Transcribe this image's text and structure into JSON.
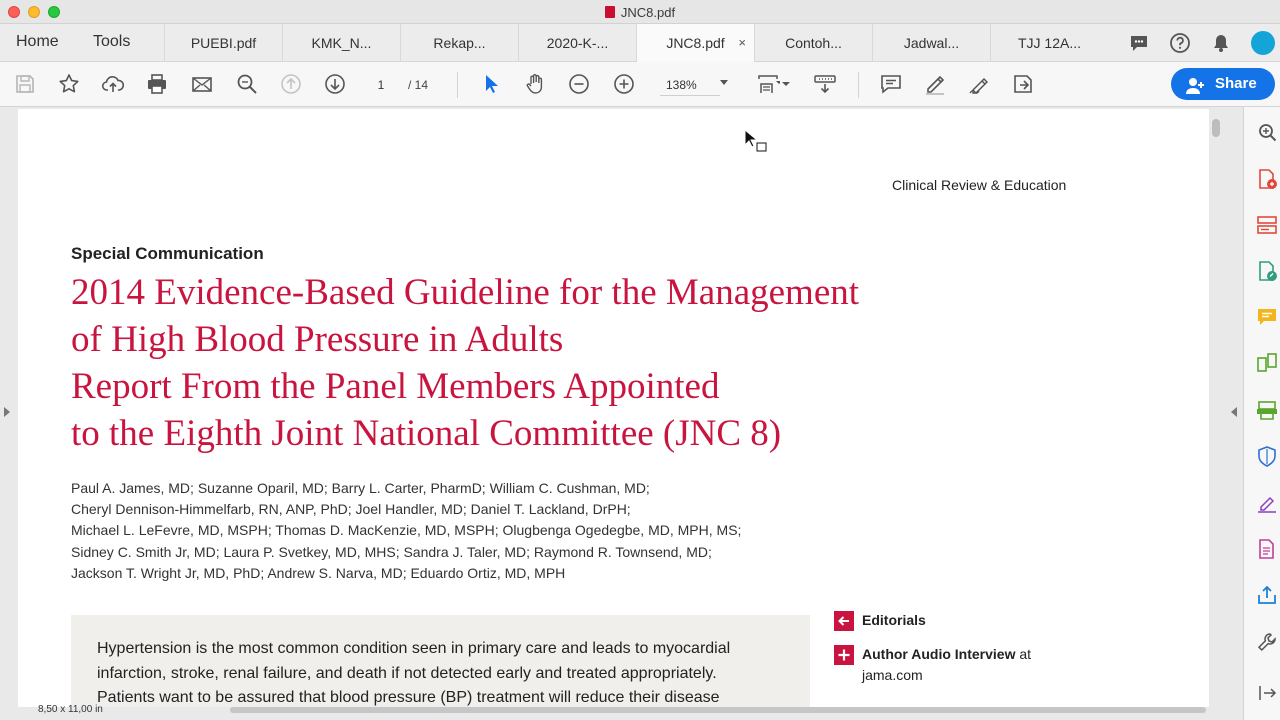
{
  "window": {
    "title": "JNC8.pdf"
  },
  "nav": {
    "home": "Home",
    "tools": "Tools"
  },
  "tabs": [
    {
      "label": "PUEBI.pdf"
    },
    {
      "label": "KMK_N..."
    },
    {
      "label": "Rekap..."
    },
    {
      "label": "2020-K-..."
    },
    {
      "label": "JNC8.pdf",
      "active": true,
      "close": "×"
    },
    {
      "label": "Contoh..."
    },
    {
      "label": "Jadwal..."
    },
    {
      "label": "TJJ 12A..."
    }
  ],
  "toolbar": {
    "page_current": "1",
    "page_total": "/ 14",
    "zoom": "138%",
    "share_label": "Share"
  },
  "colors": {
    "accent": "#1473e6",
    "title_red": "#c8143e",
    "abstract_bg": "#f0efec"
  },
  "document": {
    "section_label": "Clinical Review & Education",
    "kicker": "Special Communication",
    "title_line1": "2014 Evidence-Based Guideline for the Management",
    "title_line2": "of High Blood Pressure in Adults",
    "subtitle_line1": "Report From the Panel Members Appointed",
    "subtitle_line2": "to the Eighth Joint National Committee (JNC 8)",
    "authors": [
      "Paul A. James, MD; Suzanne Oparil, MD; Barry L. Carter, PharmD; William C. Cushman, MD;",
      "Cheryl Dennison-Himmelfarb, RN, ANP, PhD; Joel Handler, MD; Daniel T. Lackland, DrPH;",
      "Michael L. LeFevre, MD, MSPH; Thomas D. MacKenzie, MD, MSPH; Olugbenga Ogedegbe, MD, MPH, MS;",
      "Sidney C. Smith Jr, MD; Laura P. Svetkey, MD, MHS; Sandra J. Taler, MD; Raymond R. Townsend, MD;",
      "Jackson T. Wright Jr, MD, PhD; Andrew S. Narva, MD; Eduardo Ortiz, MD, MPH"
    ],
    "abstract_lines": [
      "Hypertension is the most common condition seen in primary care and leads to myocardial",
      "infarction, stroke, renal failure, and death if not detected early and treated appropriately.",
      "Patients want to be assured that blood pressure (BP) treatment will reduce their disease"
    ],
    "related": {
      "editorials": "Editorials",
      "audio_bold": "Author Audio Interview",
      "audio_rest": " at",
      "audio_line2": "jama.com"
    },
    "page_size": "8,50 x 11,00 in"
  },
  "icons": {
    "toolbar": [
      "save-icon",
      "star-icon",
      "upload-cloud-icon",
      "print-icon",
      "mail-icon",
      "zoom-search-icon",
      "page-up-icon",
      "page-down-icon",
      "select-arrow-icon",
      "hand-icon",
      "zoom-out-icon",
      "zoom-in-icon",
      "fit-page-icon",
      "scroll-mode-icon",
      "comment-icon",
      "highlight-pen-icon",
      "sign-icon",
      "fill-sign-icon"
    ],
    "right_panel": [
      "search-zoom-icon",
      "export-pdf-icon",
      "organize-pages-icon",
      "edit-pdf-icon",
      "comment-icon",
      "combine-files-icon",
      "scan-icon",
      "protect-icon",
      "fill-sign-icon",
      "create-pdf-icon",
      "share-icon",
      "tools-wrench-icon",
      "expand-icon"
    ]
  }
}
